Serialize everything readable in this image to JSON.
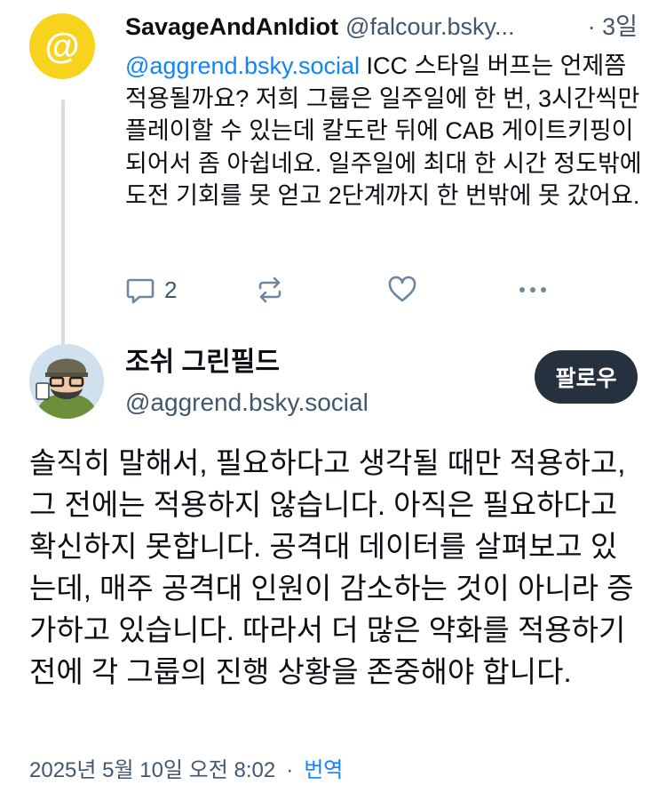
{
  "reply": {
    "display_name": "SavageAndAnIdiot",
    "handle": "@falcour.bsky...",
    "time": "· 3일",
    "avatar_icon": "at-sign-icon",
    "avatar_glyph": "@",
    "avatar_color": "#f7d31d",
    "mention": "@aggrend.bsky.social",
    "text": " ICC 스타일 버프는 언제쯤 적용될까요? 저희 그룹은 일주일에 한 번, 3시간씩만 플레이할 수 있는데 칼도란 뒤에 CAB 게이트키핑이 되어서 좀 아쉽네요. 일주일에 최대 한 시간 정도밖에 도전 기회를 못 얻고 2단계까지 한 번밖에 못 갔어요.",
    "reply_count": "2"
  },
  "post": {
    "author_name": "조쉬 그린필드",
    "author_handle": "@aggrend.bsky.social",
    "follow_label": "팔로우",
    "text": "솔직히 말해서, 필요하다고 생각될 때만 적용하고, 그 전에는 적용하지 않습니다. 아직은 필요하다고 확신하지 못합니다. 공격대 데이터를 살펴보고 있는데, 매주 공격대 인원이 감소하는 것이 아니라 증가하고 있습니다. 따라서 더 많은 약화를 적용하기 전에 각 그룹의 진행 상황을 존중해야 합니다.",
    "timestamp": "2025년 5월 10일 오전 8:02",
    "separator": "·",
    "translate_label": "번역"
  },
  "colors": {
    "accent": "#1083fe",
    "follow_bg": "#26313f",
    "muted": "#42576c"
  }
}
